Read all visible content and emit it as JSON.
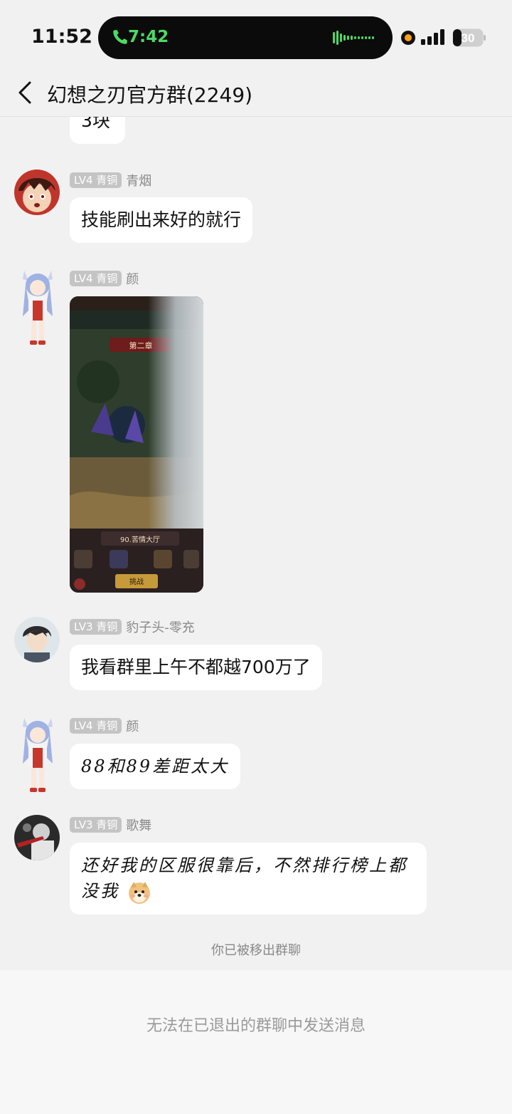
{
  "status_bar": {
    "time": "11:52",
    "call_time": "7:42",
    "battery_level": "30",
    "call_color": "#4cd964",
    "record_dot_color": "#ff9f1c"
  },
  "header": {
    "back_icon": "chevron-left-icon",
    "title": "幻想之刃官方群(2249)"
  },
  "messages": [
    {
      "sender": "",
      "level": "",
      "text": "3块"
    },
    {
      "sender": "青烟",
      "level": "LV4 青铜",
      "text": "技能刷出来好的就行"
    },
    {
      "sender": "颜",
      "level": "LV4 青铜",
      "type": "image",
      "image_text": {
        "chapter": "第二章",
        "stage": "90.苦情大厅",
        "button": "挑战"
      }
    },
    {
      "sender": "豹子头-零充",
      "level": "LV3 青铜",
      "text": "我看群里上午不都越700万了"
    },
    {
      "sender": "颜",
      "level": "LV4 青铜",
      "text": "88和89差距太大"
    },
    {
      "sender": "歌舞",
      "level": "LV3 青铜",
      "text_line1": "还好我的区服很靠后，不然排行榜上都",
      "text_line2": "没我",
      "emoji": "doge-face-icon"
    }
  ],
  "system_notice": "你已被移出群聊",
  "bottom_notice": "无法在已退出的群聊中发送消息",
  "colors": {
    "background": "#f1f1f1",
    "bubble": "#ffffff",
    "level_badge": "#c4c4c4"
  }
}
